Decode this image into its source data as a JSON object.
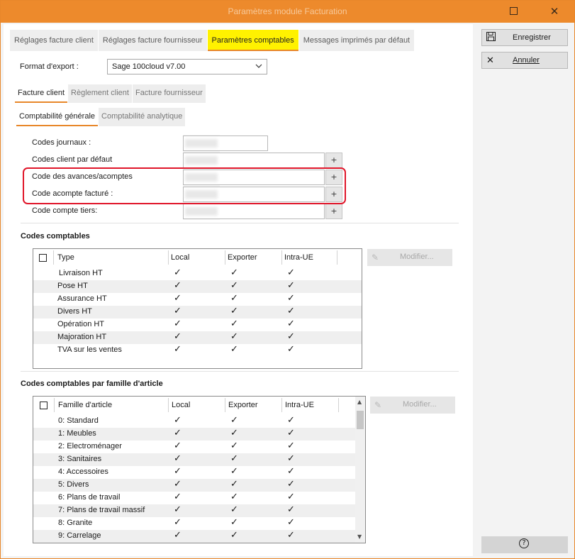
{
  "window": {
    "title": "Paramètres module Facturation"
  },
  "tabs": [
    {
      "label": "Réglages facture client"
    },
    {
      "label": "Réglages facture fournisseur"
    },
    {
      "label": "Paramètres comptables"
    },
    {
      "label": "Messages imprimés par défaut"
    }
  ],
  "export": {
    "label": "Format d'export :",
    "value": "Sage 100cloud v7.00"
  },
  "subtabs": [
    {
      "label": "Facture client"
    },
    {
      "label": "Règlement client"
    },
    {
      "label": "Facture fournisseur"
    }
  ],
  "subsubtabs": [
    {
      "label": "Comptabilité générale"
    },
    {
      "label": "Comptabilité analytique"
    }
  ],
  "fields": [
    {
      "label": "Codes journaux :"
    },
    {
      "label": "Codes client par défaut"
    },
    {
      "label": "Code des avances/acomptes"
    },
    {
      "label": "Code acompte facturé :"
    },
    {
      "label": "Code compte tiers:"
    }
  ],
  "plus_label": "+",
  "codes": {
    "title": "Codes comptables",
    "headers": {
      "type": "Type",
      "local": "Local",
      "exporter": "Exporter",
      "intra": "Intra-UE"
    },
    "rows": [
      {
        "type": "Livraison HT",
        "check": "✓"
      },
      {
        "type": "Pose HT",
        "check": "✓"
      },
      {
        "type": "Assurance HT",
        "check": "✓"
      },
      {
        "type": "Divers HT",
        "check": "✓"
      },
      {
        "type": "Opération HT",
        "check": "✓"
      },
      {
        "type": "Majoration HT",
        "check": "✓"
      },
      {
        "type": "TVA sur les ventes",
        "check": "✓"
      }
    ],
    "modify": "Modifier..."
  },
  "family": {
    "title": "Codes comptables par famille d'article",
    "headers": {
      "type": "Famille d'article",
      "local": "Local",
      "exporter": "Exporter",
      "intra": "Intra-UE"
    },
    "rows": [
      {
        "type": "0: Standard",
        "check": "✓"
      },
      {
        "type": "1: Meubles",
        "check": "✓"
      },
      {
        "type": "2: Electroménager",
        "check": "✓"
      },
      {
        "type": "3: Sanitaires",
        "check": "✓"
      },
      {
        "type": "4: Accessoires",
        "check": "✓"
      },
      {
        "type": "5: Divers",
        "check": "✓"
      },
      {
        "type": "6: Plans de travail",
        "check": "✓"
      },
      {
        "type": "7: Plans de travail massif",
        "check": "✓"
      },
      {
        "type": "8: Granite",
        "check": "✓"
      },
      {
        "type": "9: Carrelage",
        "check": "✓"
      }
    ],
    "modify": "Modifier..."
  },
  "actions": {
    "save": "Enregistrer",
    "cancel": "Annuler",
    "help": "?"
  },
  "colors": {
    "accent": "#ED8A2C",
    "tab_highlight": "#FFF200",
    "annotation": "#E0162A"
  }
}
